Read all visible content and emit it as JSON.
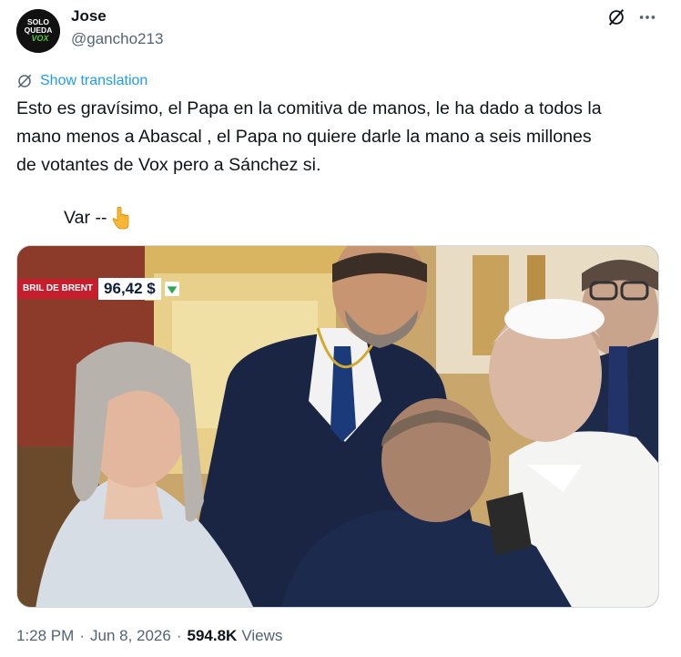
{
  "author": {
    "name": "Jose",
    "handle": "@gancho213",
    "avatar_text": [
      "SOLO",
      "QUEDA",
      "VOX"
    ]
  },
  "icons": {
    "grok": "grok-icon",
    "more": "more-icon",
    "translate": "globe-icon",
    "emoji": "pointing-down-emoji"
  },
  "translate": {
    "label": "Show translation"
  },
  "tweet": {
    "lines": [
      "Esto es gravísimo, el Papa en la comitiva de manos, le ha dado a todos la",
      "mano menos a Abascal , el Papa no quiere darle la mano a seis millones",
      "de votantes de Vox pero a Sánchez si."
    ],
    "var_text": "Var --"
  },
  "media": {
    "ticker_label": "BRIL DE BRENT",
    "ticker_value": "96,42 $",
    "ticker_trend": "down"
  },
  "meta": {
    "time": "1:28 PM",
    "date": "Jun 8, 2026",
    "views": "594.8K",
    "views_label": "Views"
  },
  "colors": {
    "link": "#1d9bf0",
    "text": "#0f1419",
    "muted": "#536471",
    "avatar_accent": "#5ac73f"
  }
}
